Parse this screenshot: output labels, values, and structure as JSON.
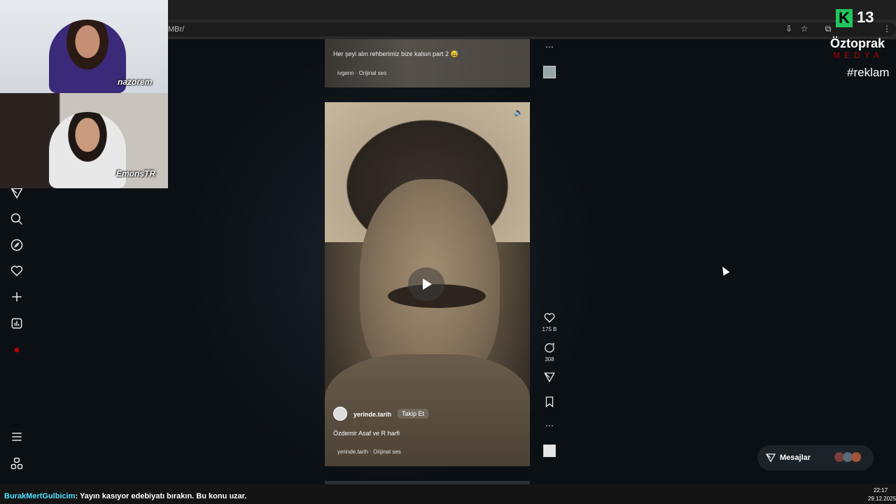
{
  "browser": {
    "url_fragment": "MBr/"
  },
  "sidebar": {
    "items": [
      "messages-icon",
      "search-icon",
      "explore-icon",
      "heart-icon",
      "plus-icon",
      "stats-icon",
      "profile-icon",
      "menu-icon",
      "apps-icon"
    ]
  },
  "reel_top": {
    "caption": "Her şeyi alın rehberimiz bize kalsın part 2 😅",
    "audio": "ivgenn · Orijinal ses"
  },
  "reel_main": {
    "author": "yerinde.tarih",
    "follow_label": "Takip Et",
    "caption": "Özdemir Asaf ve R harfi",
    "audio": "yerinde.tarih · Orijinal ses"
  },
  "actions": {
    "likes": "175 B",
    "comments": "308"
  },
  "overlay": {
    "cam1_label": "nazorem",
    "cam2_label": "EmonsTR",
    "brand_number": "13",
    "brand_letter": "K",
    "brand_name": "Öztoprak",
    "brand_sub": "MEDYA",
    "brand_tag": "#reklam"
  },
  "messages": {
    "label": "Mesajlar"
  },
  "chat": {
    "user": "BurakMertGulbicim",
    "text": ": Yayın kasıyor edebiyatı bırakın. Bu konu uzar."
  },
  "clock": {
    "time": "22:17",
    "date": "29.12.2025"
  }
}
